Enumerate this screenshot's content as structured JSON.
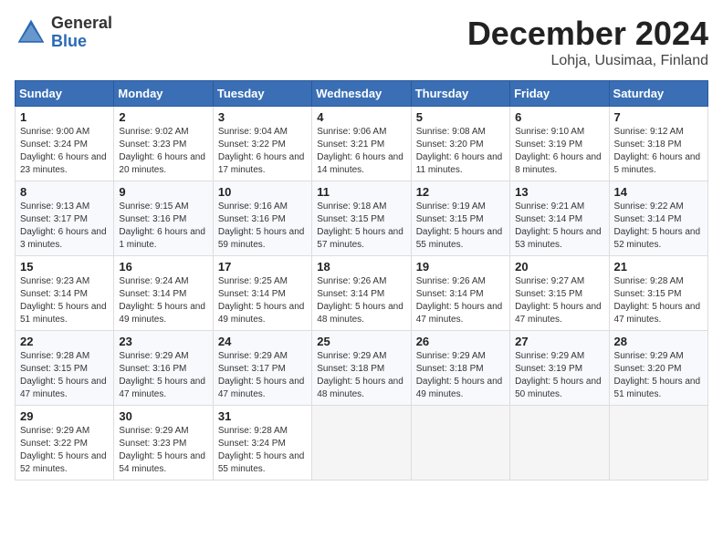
{
  "header": {
    "logo_general": "General",
    "logo_blue": "Blue",
    "month_title": "December 2024",
    "location": "Lohja, Uusimaa, Finland"
  },
  "days_of_week": [
    "Sunday",
    "Monday",
    "Tuesday",
    "Wednesday",
    "Thursday",
    "Friday",
    "Saturday"
  ],
  "weeks": [
    [
      {
        "day": "1",
        "sunrise": "9:00 AM",
        "sunset": "3:24 PM",
        "daylight": "6 hours and 23 minutes."
      },
      {
        "day": "2",
        "sunrise": "9:02 AM",
        "sunset": "3:23 PM",
        "daylight": "6 hours and 20 minutes."
      },
      {
        "day": "3",
        "sunrise": "9:04 AM",
        "sunset": "3:22 PM",
        "daylight": "6 hours and 17 minutes."
      },
      {
        "day": "4",
        "sunrise": "9:06 AM",
        "sunset": "3:21 PM",
        "daylight": "6 hours and 14 minutes."
      },
      {
        "day": "5",
        "sunrise": "9:08 AM",
        "sunset": "3:20 PM",
        "daylight": "6 hours and 11 minutes."
      },
      {
        "day": "6",
        "sunrise": "9:10 AM",
        "sunset": "3:19 PM",
        "daylight": "6 hours and 8 minutes."
      },
      {
        "day": "7",
        "sunrise": "9:12 AM",
        "sunset": "3:18 PM",
        "daylight": "6 hours and 5 minutes."
      }
    ],
    [
      {
        "day": "8",
        "sunrise": "9:13 AM",
        "sunset": "3:17 PM",
        "daylight": "6 hours and 3 minutes."
      },
      {
        "day": "9",
        "sunrise": "9:15 AM",
        "sunset": "3:16 PM",
        "daylight": "6 hours and 1 minute."
      },
      {
        "day": "10",
        "sunrise": "9:16 AM",
        "sunset": "3:16 PM",
        "daylight": "5 hours and 59 minutes."
      },
      {
        "day": "11",
        "sunrise": "9:18 AM",
        "sunset": "3:15 PM",
        "daylight": "5 hours and 57 minutes."
      },
      {
        "day": "12",
        "sunrise": "9:19 AM",
        "sunset": "3:15 PM",
        "daylight": "5 hours and 55 minutes."
      },
      {
        "day": "13",
        "sunrise": "9:21 AM",
        "sunset": "3:14 PM",
        "daylight": "5 hours and 53 minutes."
      },
      {
        "day": "14",
        "sunrise": "9:22 AM",
        "sunset": "3:14 PM",
        "daylight": "5 hours and 52 minutes."
      }
    ],
    [
      {
        "day": "15",
        "sunrise": "9:23 AM",
        "sunset": "3:14 PM",
        "daylight": "5 hours and 51 minutes."
      },
      {
        "day": "16",
        "sunrise": "9:24 AM",
        "sunset": "3:14 PM",
        "daylight": "5 hours and 49 minutes."
      },
      {
        "day": "17",
        "sunrise": "9:25 AM",
        "sunset": "3:14 PM",
        "daylight": "5 hours and 49 minutes."
      },
      {
        "day": "18",
        "sunrise": "9:26 AM",
        "sunset": "3:14 PM",
        "daylight": "5 hours and 48 minutes."
      },
      {
        "day": "19",
        "sunrise": "9:26 AM",
        "sunset": "3:14 PM",
        "daylight": "5 hours and 47 minutes."
      },
      {
        "day": "20",
        "sunrise": "9:27 AM",
        "sunset": "3:15 PM",
        "daylight": "5 hours and 47 minutes."
      },
      {
        "day": "21",
        "sunrise": "9:28 AM",
        "sunset": "3:15 PM",
        "daylight": "5 hours and 47 minutes."
      }
    ],
    [
      {
        "day": "22",
        "sunrise": "9:28 AM",
        "sunset": "3:15 PM",
        "daylight": "5 hours and 47 minutes."
      },
      {
        "day": "23",
        "sunrise": "9:29 AM",
        "sunset": "3:16 PM",
        "daylight": "5 hours and 47 minutes."
      },
      {
        "day": "24",
        "sunrise": "9:29 AM",
        "sunset": "3:17 PM",
        "daylight": "5 hours and 47 minutes."
      },
      {
        "day": "25",
        "sunrise": "9:29 AM",
        "sunset": "3:18 PM",
        "daylight": "5 hours and 48 minutes."
      },
      {
        "day": "26",
        "sunrise": "9:29 AM",
        "sunset": "3:18 PM",
        "daylight": "5 hours and 49 minutes."
      },
      {
        "day": "27",
        "sunrise": "9:29 AM",
        "sunset": "3:19 PM",
        "daylight": "5 hours and 50 minutes."
      },
      {
        "day": "28",
        "sunrise": "9:29 AM",
        "sunset": "3:20 PM",
        "daylight": "5 hours and 51 minutes."
      }
    ],
    [
      {
        "day": "29",
        "sunrise": "9:29 AM",
        "sunset": "3:22 PM",
        "daylight": "5 hours and 52 minutes."
      },
      {
        "day": "30",
        "sunrise": "9:29 AM",
        "sunset": "3:23 PM",
        "daylight": "5 hours and 54 minutes."
      },
      {
        "day": "31",
        "sunrise": "9:28 AM",
        "sunset": "3:24 PM",
        "daylight": "5 hours and 55 minutes."
      },
      null,
      null,
      null,
      null
    ]
  ]
}
